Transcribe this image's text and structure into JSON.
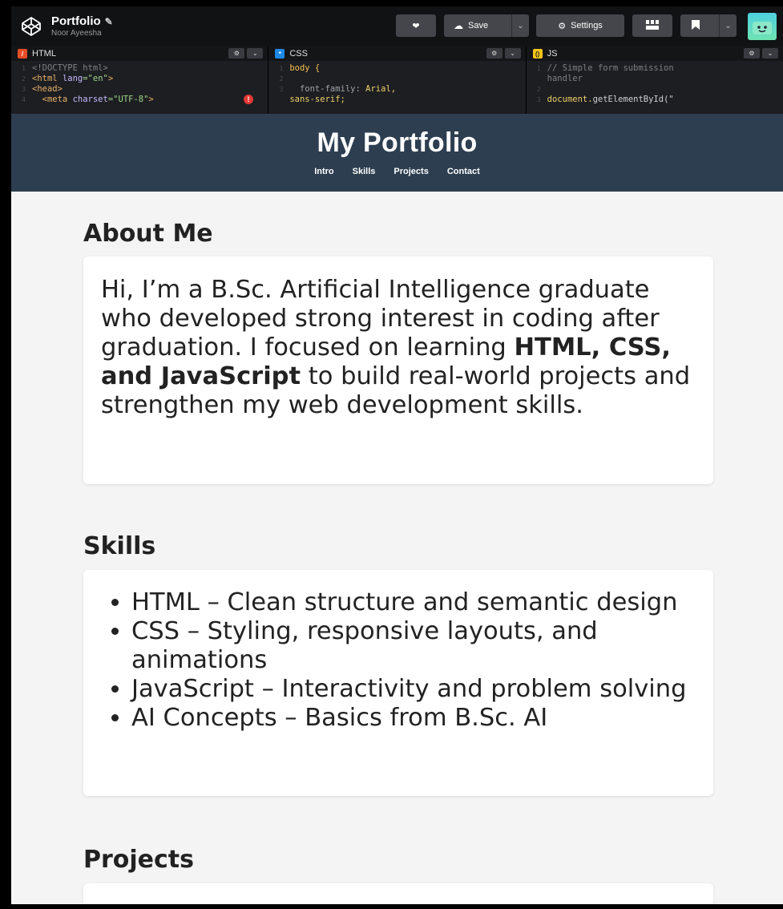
{
  "topbar": {
    "project_title": "Portfolio",
    "author": "Noor Ayeesha",
    "save_label": "Save",
    "settings_label": "Settings"
  },
  "editors": {
    "html": {
      "label": "HTML",
      "lines": [
        {
          "num": "1",
          "parts": [
            {
              "t": "<!DOCTYPE html>",
              "c": "c-com"
            }
          ]
        },
        {
          "num": "2",
          "parts": [
            {
              "t": "<html ",
              "c": "c-tag"
            },
            {
              "t": "lang",
              "c": "c-attr"
            },
            {
              "t": "=\"en\"",
              "c": "c-str"
            },
            {
              "t": ">",
              "c": "c-tag"
            }
          ]
        },
        {
          "num": "3",
          "parts": [
            {
              "t": "<head>",
              "c": "c-tag"
            }
          ]
        },
        {
          "num": "4",
          "parts": [
            {
              "t": "  <meta ",
              "c": "c-tag"
            },
            {
              "t": "charset",
              "c": "c-attr"
            },
            {
              "t": "=\"UTF-8\"",
              "c": "c-str"
            },
            {
              "t": ">",
              "c": "c-tag"
            }
          ]
        }
      ]
    },
    "css": {
      "label": "CSS",
      "lines": [
        {
          "num": "1",
          "parts": [
            {
              "t": "body {",
              "c": "c-sel"
            }
          ]
        },
        {
          "num": "2",
          "parts": [
            {
              "t": "",
              "c": "c-plain"
            }
          ]
        },
        {
          "num": "3",
          "parts": [
            {
              "t": "  font-family: ",
              "c": "c-prop"
            },
            {
              "t": "Arial,",
              "c": "c-val"
            }
          ]
        },
        {
          "num": "",
          "parts": [
            {
              "t": "sans-serif;",
              "c": "c-val"
            }
          ]
        }
      ]
    },
    "js": {
      "label": "JS",
      "lines": [
        {
          "num": "1",
          "parts": [
            {
              "t": "// Simple form submission",
              "c": "c-com"
            }
          ]
        },
        {
          "num": "",
          "parts": [
            {
              "t": "handler",
              "c": "c-com"
            }
          ]
        },
        {
          "num": "2",
          "parts": [
            {
              "t": "",
              "c": "c-plain"
            }
          ]
        },
        {
          "num": "3",
          "parts": [
            {
              "t": "document.",
              "c": "c-val"
            },
            {
              "t": "getElementById(\"",
              "c": "c-plain"
            }
          ]
        }
      ]
    }
  },
  "site": {
    "title": "My Portfolio",
    "nav": [
      "Intro",
      "Skills",
      "Projects",
      "Contact"
    ]
  },
  "about": {
    "heading": "About Me",
    "text_before": "Hi, I’m a B.Sc. Artificial Intelligence graduate who developed strong interest in coding after graduation. I focused on learning ",
    "text_bold": "HTML, CSS, and JavaScript",
    "text_after": " to build real-world projects and strengthen my web development skills."
  },
  "skills": {
    "heading": "Skills",
    "items": [
      "HTML – Clean structure and semantic design",
      "CSS – Styling, responsive layouts, and animations",
      "JavaScript – Interactivity and problem solving",
      "AI Concepts – Basics from B.Sc. AI"
    ]
  },
  "projects": {
    "heading": "Projects"
  },
  "colors": {
    "header_bg": "#2d3e50",
    "html_badge": "#e44d26",
    "css_badge": "#1e88e5",
    "js_badge": "#f5c518"
  }
}
